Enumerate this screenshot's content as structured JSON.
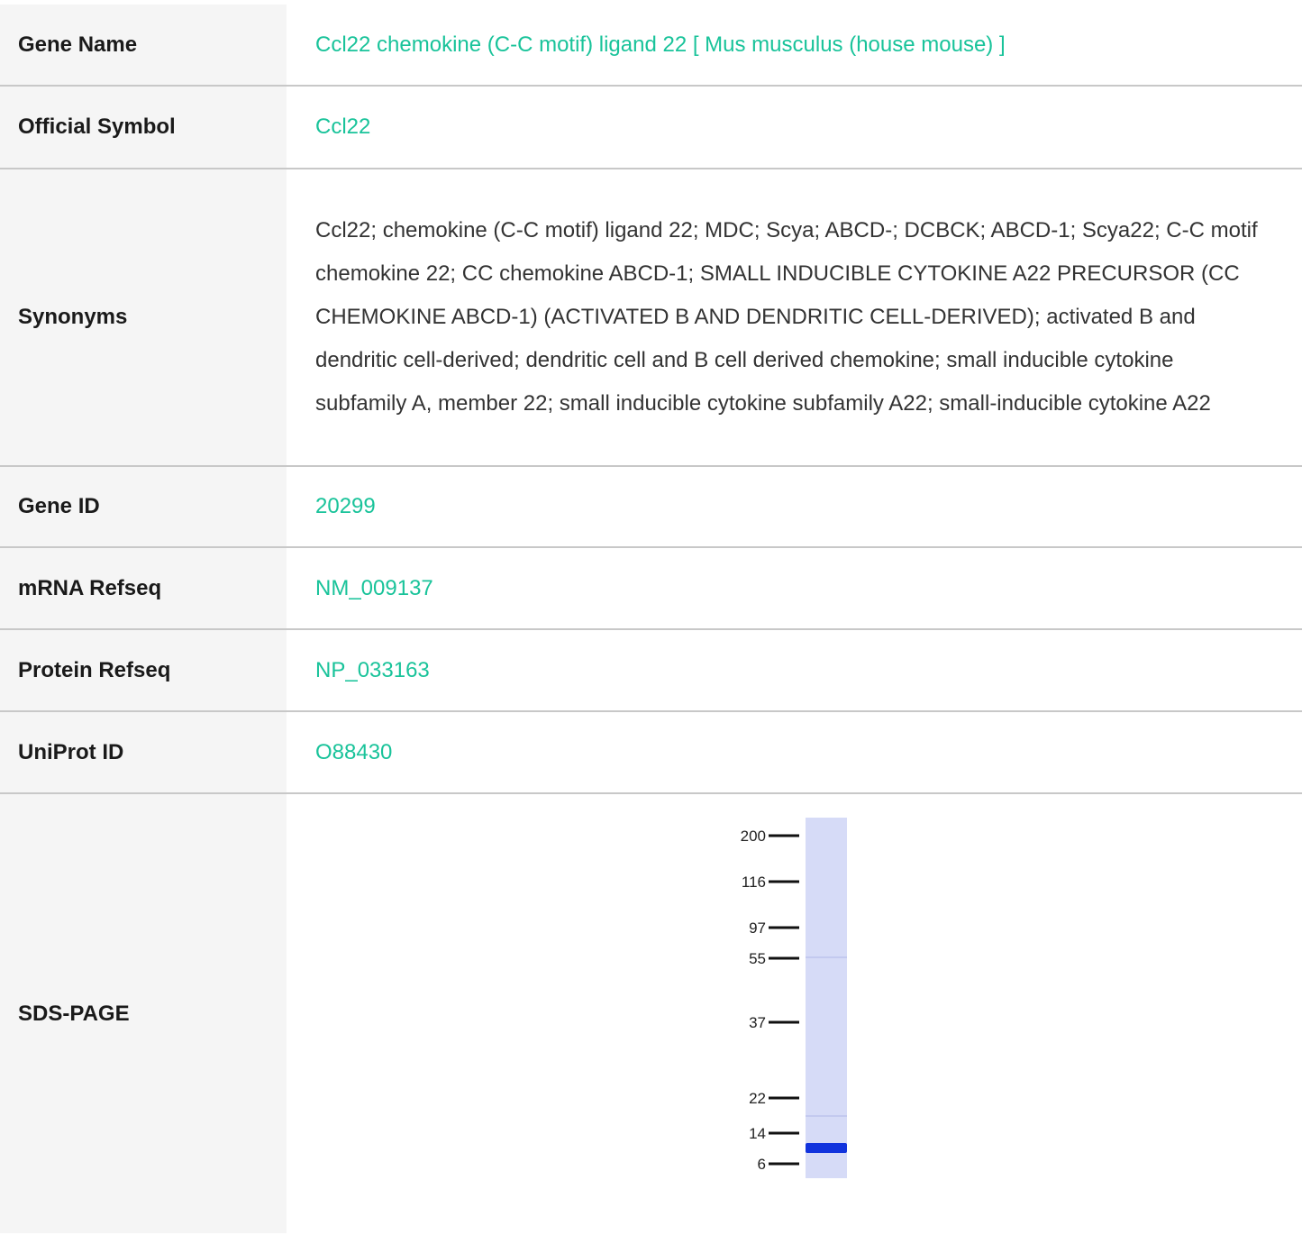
{
  "rows": [
    {
      "label": "Gene Name",
      "value": "Ccl22 chemokine (C-C motif) ligand 22 [ Mus musculus (house mouse) ]",
      "link": true
    },
    {
      "label": "Official Symbol",
      "value": "Ccl22",
      "link": true
    },
    {
      "label": "Synonyms",
      "value": "Ccl22; chemokine (C-C motif) ligand 22; MDC; Scya; ABCD-; DCBCK; ABCD-1; Scya22; C-C motif chemokine 22; CC chemokine ABCD-1; SMALL INDUCIBLE CYTOKINE A22 PRECURSOR (CC CHEMOKINE ABCD-1) (ACTIVATED B AND DENDRITIC CELL-DERIVED); activated B and dendritic cell-derived; dendritic cell and B cell derived chemokine; small inducible cytokine subfamily A, member 22; small inducible cytokine subfamily A22; small-inducible cytokine A22",
      "link": false
    },
    {
      "label": "Gene ID",
      "value": "20299",
      "link": true
    },
    {
      "label": "mRNA Refseq",
      "value": "NM_009137",
      "link": true
    },
    {
      "label": "Protein Refseq",
      "value": "NP_033163",
      "link": true
    },
    {
      "label": "UniProt ID",
      "value": "O88430",
      "link": true
    },
    {
      "label": "SDS-PAGE",
      "value": "",
      "link": false
    }
  ],
  "gel": {
    "markers": [
      "200",
      "116",
      "97",
      "55",
      "37",
      "22",
      "14",
      "6"
    ],
    "lane_color": "#d6dbf7",
    "band_color": "#1133dd"
  },
  "colors": {
    "link": "#19c39a",
    "label_bg": "#f5f5f5",
    "divider": "#c8c8c8"
  }
}
